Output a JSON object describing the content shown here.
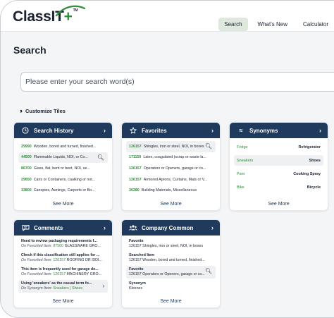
{
  "brand": {
    "logo_text": "ClassIT",
    "logo_plus": "+",
    "logo_tm": "TM"
  },
  "nav": {
    "tabs": [
      "Search",
      "What's New",
      "Calculator"
    ],
    "active": "Search"
  },
  "page": {
    "title": "Search"
  },
  "search": {
    "placeholder": "Please enter your search word(s)"
  },
  "customize": {
    "label": "Customize Tiles"
  },
  "colors": {
    "header": "#1f3a5c",
    "code_green": "#2f8d3a",
    "active_tab": "#dfe8dd"
  },
  "tiles": {
    "search_history": {
      "title": "Search History",
      "icon": "clock-icon",
      "rows": [
        {
          "code": "29990",
          "text": "Wooden, bored and turned, finished..."
        },
        {
          "code": "44500",
          "text": "Flammable Liquids, NOI, or Co..."
        },
        {
          "code": "86700",
          "text": "Glass, flat, bent or bent, NOI, se..."
        },
        {
          "code": "29650",
          "text": "Cans or Containers, caulking or not..."
        },
        {
          "code": "33800",
          "text": "Canopies, Awnings, Carports or Bo..."
        }
      ],
      "see_more": "See More"
    },
    "favorites": {
      "title": "Favorites",
      "icon": "star-icon",
      "rows": [
        {
          "code": "126157",
          "text": "Shingles, iron or steel, NOI, in boxes"
        },
        {
          "code": "171150",
          "text": "Latex, coagulated (scrap or waste la..."
        },
        {
          "code": "126157",
          "text": "Operators or Openers, garage or co..."
        },
        {
          "code": "126157",
          "text": "Armored Aprons, Curtains, Mats or V..."
        },
        {
          "code": "36380",
          "text": "Building Materials, Miscellaneous"
        }
      ],
      "see_more": "See More"
    },
    "synonyms": {
      "title": "Synonyms",
      "icon": "approx-icon",
      "rows": [
        {
          "left": "Fridge",
          "right": "Refrigerator"
        },
        {
          "left": "Sneakers",
          "right": "Shoes"
        },
        {
          "left": "Pam",
          "right": "Cooking Spray"
        },
        {
          "left": "Bike",
          "right": "Bicycle"
        }
      ],
      "see_more": "See More"
    },
    "comments": {
      "title": "Comments",
      "icon": "chat-icon",
      "rows": [
        {
          "title": "Need to review packaging requirements f...",
          "prefix": "On Favorited Item: ",
          "code": "87500",
          "name": "GLASSWARE GRO..."
        },
        {
          "title": "Check if this classification still applies for ...",
          "prefix": "On Favorited Item: ",
          "code": "126157",
          "name": "ROOFING OR SIDI..."
        },
        {
          "title": "This item is frequently used for garage do...",
          "prefix": "On Favorited Item: ",
          "code": "126157",
          "name": "MACHINERY GRO..."
        },
        {
          "title": "Using 'sneakers' as the casual term fo...",
          "prefix": "On Synonym Item: ",
          "code": "Sneakers",
          "name": "| Shoes"
        }
      ],
      "see_more": "See More"
    },
    "company_common": {
      "title": "Company Common",
      "icon": "group-icon",
      "rows": [
        {
          "title": "Favorite",
          "text": "126157 Shingles, iron or steel, NOI, in boxes"
        },
        {
          "title": "Searched Item",
          "text": "126157 Wooden, bored and turned, finished..."
        },
        {
          "title": "Favorite",
          "text": "126157 Operators or Openers, garage or co..."
        },
        {
          "title": "Synonym",
          "text": "Kleenex"
        }
      ],
      "see_more": "See More"
    }
  }
}
